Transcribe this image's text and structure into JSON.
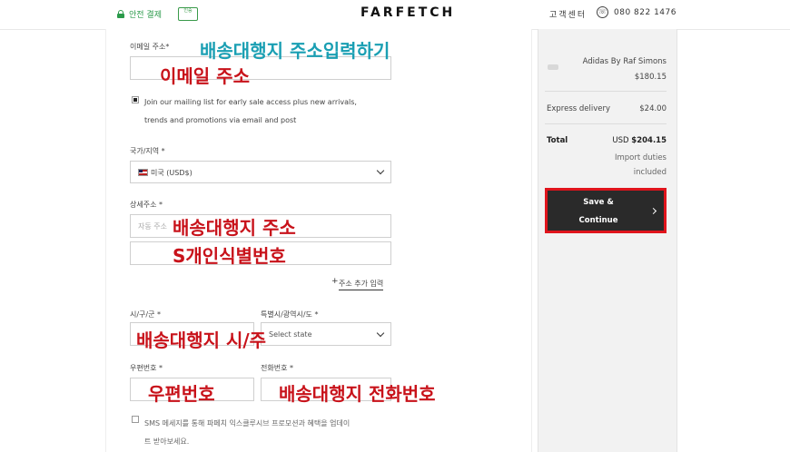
{
  "header": {
    "secure_label": "안전 결제",
    "badge_text": "인증",
    "logo": "FARFETCH",
    "customer_center": "고객센터",
    "phone": "080 822 1476"
  },
  "form": {
    "email_label": "이메일 주소*",
    "email_overlay": "이메일 주소",
    "heading_overlay": "배송대행지 주소입력하기",
    "newsletter_text_1": "Join our mailing list for early sale access plus new arrivals,",
    "newsletter_text_2": "trends and promotions via email and post",
    "country_label": "국가/지역 *",
    "country_value": "미국 (USD$)",
    "address_label": "상세주소 *",
    "address_placeholder": "자동 주소",
    "address_overlay": "배송대행지 주소",
    "address2_overlay": "S개인식별번호",
    "add_address_plus": "+",
    "add_address_link": "주소 추가 입력",
    "city_label": "시/구/군 *",
    "state_label": "특별시/광역시/도 *",
    "state_value": "Select state",
    "city_state_overlay": "배송대행지 시/주",
    "zip_label": "우편번호 *",
    "phone_label": "전화번호 *",
    "zip_overlay": "우편번호",
    "phone_overlay": "배송대행지 전화번호",
    "sms_text_1": "SMS 메세지를 통해 파페치 익스클루시브 프로모션과 혜택을 업데이",
    "sms_text_2": "트 받아보세요."
  },
  "summary": {
    "product_name": "Adidas By Raf Simons",
    "product_price": "$180.15",
    "delivery_label": "Express delivery",
    "delivery_price": "$24.00",
    "total_label": "Total",
    "total_currency": "USD",
    "total_value": "$204.15",
    "import_1": "Import duties",
    "import_2": "included",
    "save_1": "Save &",
    "save_2": "Continue"
  },
  "colors": {
    "overlay_red": "#c8121a",
    "overlay_teal": "#1a9fb3",
    "button_bg": "#2a2a2a",
    "button_border": "#e0141c"
  }
}
